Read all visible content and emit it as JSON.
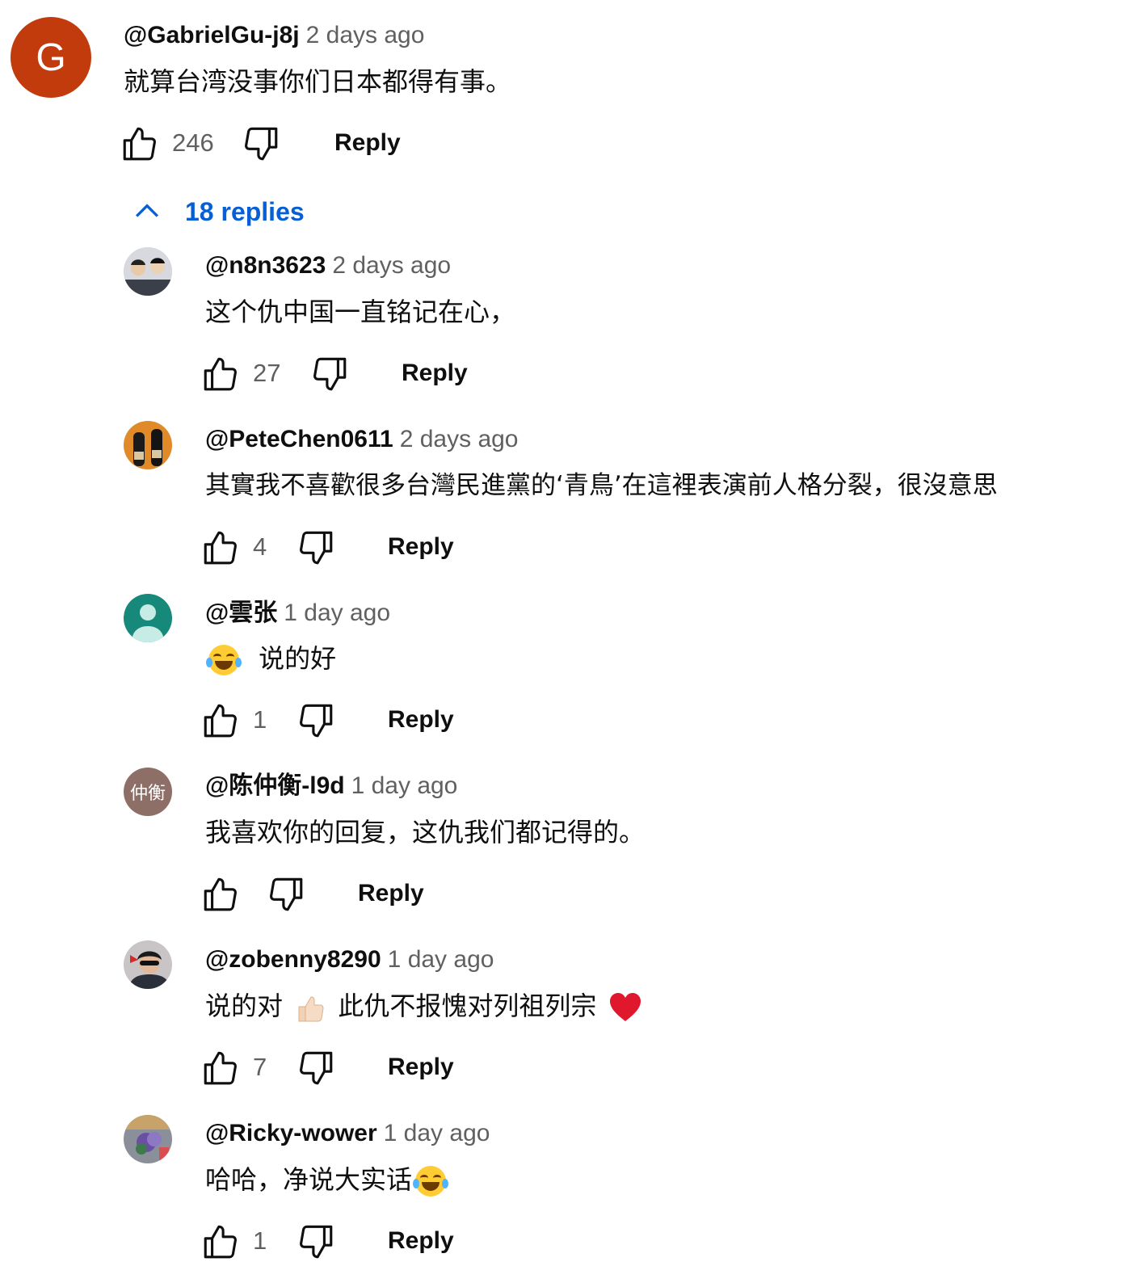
{
  "top_comment": {
    "avatar_letter": "G",
    "author": "@GabrielGu-j8j",
    "time": "2 days ago",
    "text": "就算台湾没事你们日本都得有事。",
    "likes": "246",
    "reply_label": "Reply"
  },
  "replies_toggle": {
    "label": "18 replies"
  },
  "replies": [
    {
      "author": "@n8n3623",
      "time": "2 days ago",
      "text": "这个仇中国一直铭记在心，",
      "likes": "27",
      "reply_label": "Reply"
    },
    {
      "author": "@PeteChen0611",
      "time": "2 days ago",
      "text": "其實我不喜歡很多台灣民進黨的‘青鳥’在這裡表演前人格分裂，很沒意思",
      "likes": "4",
      "reply_label": "Reply"
    },
    {
      "author": "@雲张",
      "time": "1 day ago",
      "text": "说的好",
      "likes": "1",
      "reply_label": "Reply"
    },
    {
      "author": "@陈仲衡-l9d",
      "time": "1 day ago",
      "text": "我喜欢你的回复，这仇我们都记得的。",
      "likes": "",
      "reply_label": "Reply",
      "avatar_text": "仲衡"
    },
    {
      "author": "@zobenny8290",
      "time": "1 day ago",
      "text_a": "说的对",
      "text_b": "此仇不报愧对列祖列宗",
      "likes": "7",
      "reply_label": "Reply"
    },
    {
      "author": "@Ricky-wower",
      "time": "1 day ago",
      "text": "哈哈，净说大实话",
      "likes": "1",
      "reply_label": "Reply"
    }
  ],
  "colors": {
    "link_blue": "#065fd4",
    "meta_gray": "#606060",
    "avatar_g": "#c23b0d"
  }
}
